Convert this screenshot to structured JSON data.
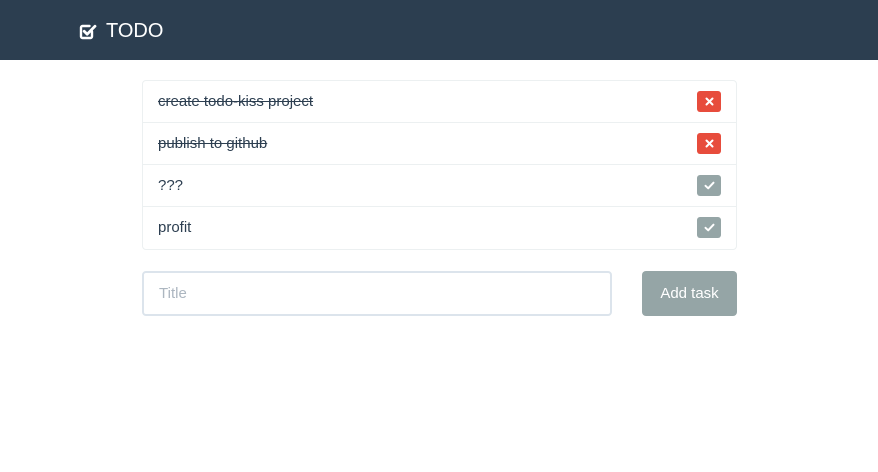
{
  "app": {
    "title": "TODO",
    "brand_icon": "checked-square-icon"
  },
  "tasks": [
    {
      "title": "create todo-kiss project",
      "done": true,
      "action": "delete",
      "action_icon": "times-icon"
    },
    {
      "title": "publish to github",
      "done": true,
      "action": "delete",
      "action_icon": "times-icon"
    },
    {
      "title": "???",
      "done": false,
      "action": "complete",
      "action_icon": "check-icon"
    },
    {
      "title": "profit",
      "done": false,
      "action": "complete",
      "action_icon": "check-icon"
    }
  ],
  "form": {
    "title_value": "",
    "title_placeholder": "Title",
    "add_label": "Add task"
  },
  "colors": {
    "navbar": "#2c3e50",
    "delete": "#e74c3c",
    "complete": "#95a5a6",
    "border": "#ecf0f1"
  }
}
